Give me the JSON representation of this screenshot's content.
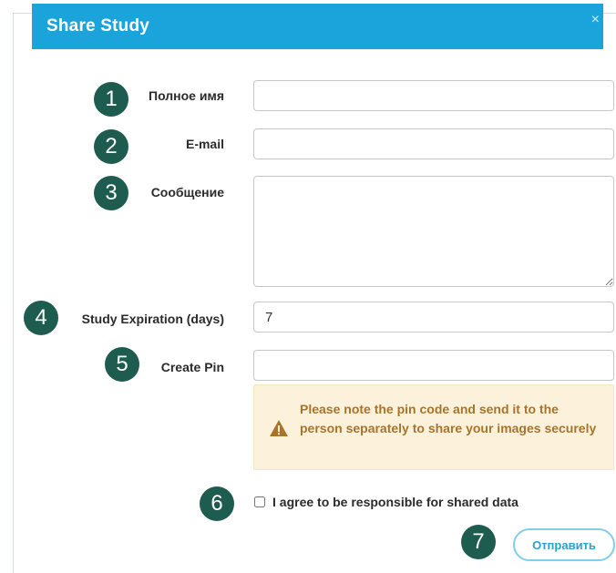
{
  "dialog": {
    "title": "Share Study",
    "close_icon": "×"
  },
  "form": {
    "full_name": {
      "label": "Полное имя",
      "value": "",
      "marker": "1"
    },
    "email": {
      "label": "E-mail",
      "value": "",
      "marker": "2"
    },
    "message": {
      "label": "Сообщение",
      "value": "",
      "marker": "3"
    },
    "expiration": {
      "label": "Study Expiration (days)",
      "value": "7",
      "marker": "4"
    },
    "pin": {
      "label": "Create Pin",
      "value": "",
      "marker": "5"
    }
  },
  "alert": {
    "icon": "warning-icon",
    "text": "Please note the pin code and send it to the person separately to share your images securely"
  },
  "agreement": {
    "label": "I agree to be responsible for shared data",
    "checked": false,
    "marker": "6"
  },
  "submit": {
    "label": "Отправить",
    "marker": "7"
  },
  "colors": {
    "header": "#1ba4dc",
    "marker": "#1e5c50",
    "alert_bg": "#fcf2dc",
    "alert_text": "#a8742a"
  }
}
